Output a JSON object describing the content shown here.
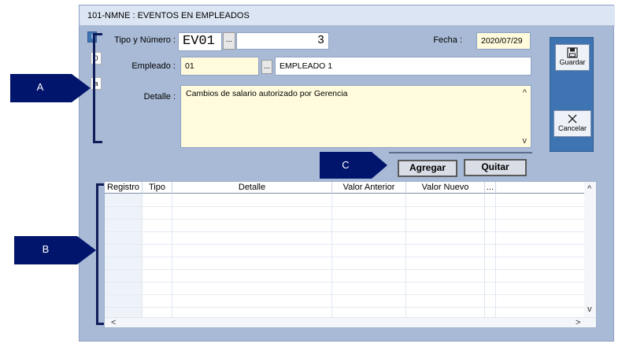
{
  "window": {
    "title": "101-NMNE : EVENTOS EN EMPLEADOS"
  },
  "form": {
    "tipo_label": "Tipo y Número :",
    "tipo_value": "EV01",
    "numero_value": "3",
    "fecha_label": "Fecha :",
    "fecha_value": "2020/07/29",
    "empleado_label": "Empleado :",
    "empleado_code": "01",
    "empleado_name": "EMPLEADO 1",
    "detalle_label": "Detalle :",
    "detalle_value": "Cambios de salario autorizado por Gerencia",
    "lookup": "...",
    "side_top": "i",
    "side_mid": "0",
    "side_low": "a"
  },
  "toolbar": {
    "save_label": "Guardar",
    "cancel_label": "Cancelar"
  },
  "actions": {
    "add_label": "Agregar",
    "remove_label": "Quitar"
  },
  "grid": {
    "columns": [
      "Registro",
      "Tipo",
      "Detalle",
      "Valor Anterior",
      "Valor Nuevo",
      "..."
    ],
    "scroll_up": "^",
    "scroll_down": "v",
    "scroll_left": "<",
    "scroll_right": ">"
  },
  "callouts": {
    "a": "A",
    "b": "B",
    "c": "C"
  },
  "colors": {
    "input_bg": "#fffbdc",
    "window_bg": "#a9bad6",
    "toolbar_bg": "#3e74b2",
    "callout_bg": "#00156b"
  }
}
